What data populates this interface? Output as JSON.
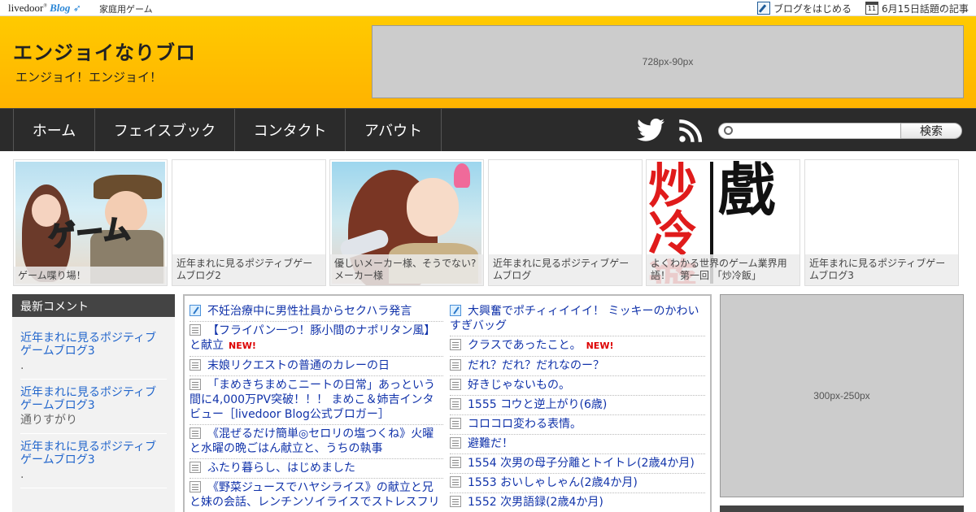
{
  "topbar": {
    "logo_text": "livedoor",
    "logo_blog": "Blog",
    "category": "家庭用ゲーム",
    "start_blog": "ブログをはじめる",
    "calendar_day": "11",
    "news_link": "6月15日話題の記事"
  },
  "header": {
    "title": "エンジョイなりブロ",
    "subtitle": "エンジョイ！エンジョイ！",
    "banner_label": "728px-90px"
  },
  "nav": {
    "items": [
      "ホーム",
      "フェイスブック",
      "コンタクト",
      "アバウト"
    ],
    "search_button": "検索",
    "search_value": ""
  },
  "thumbs": [
    {
      "caption": "ゲーム喋り場！",
      "image_text": "ゲーム"
    },
    {
      "caption": "近年まれに見るポジティブゲームブログ2"
    },
    {
      "caption": "優しいメーカー様、そうでない?メーカー様"
    },
    {
      "caption": "近年まれに見るポジティブゲームブログ"
    },
    {
      "caption": "よくわかる世界のゲーム業界用語！　第一回 「炒冷飯」",
      "image_text": "炒冷 遊戲"
    },
    {
      "caption": "近年まれに見るポジティブゲームブログ3"
    }
  ],
  "sidebar": {
    "heading": "最新コメント",
    "comments": [
      {
        "title": "近年まれに見るポジティブゲームブログ3",
        "author": "."
      },
      {
        "title": "近年まれに見るポジティブゲームブログ3",
        "author": "通りすがり"
      },
      {
        "title": "近年まれに見るポジティブゲームブログ3",
        "author": "."
      }
    ]
  },
  "entries_left": [
    {
      "text": "不妊治療中に男性社員からセクハラ発言",
      "icon": "blue"
    },
    {
      "text": "【フライパン一つ！豚小間のナポリタン風】と献立",
      "new": "NEW!"
    },
    {
      "text": "末娘リクエストの普通のカレーの日"
    },
    {
      "text": "「まめきちまめこニートの日常」あっという間に4,000万PV突破！！！ まめこ＆姉吉インタビュー［livedoor Blog公式ブロガー］"
    },
    {
      "text": "《混ぜるだけ簡単◎セロリの塩つくね》火曜と水曜の晩ごはん献立と、うちの執事"
    },
    {
      "text": "ふたり暮らし、はじめました"
    },
    {
      "text": "《野菜ジュースでハヤシライス》の献立と兄と妹の会話、レンチンソイライスでストレスフリー"
    }
  ],
  "entries_right": [
    {
      "text": "大興奮でポチィィイイイ！ ミッキーのかわいすぎバッグ",
      "icon": "blue"
    },
    {
      "text": "クラスであったこと。",
      "new": "NEW!"
    },
    {
      "text": "だれ？だれ？だれなのー？"
    },
    {
      "text": "好きじゃないもの。"
    },
    {
      "text": "1555 コウと逆上がり(6歳)"
    },
    {
      "text": "コロコロ変わる表情。"
    },
    {
      "text": "避難だ！"
    },
    {
      "text": "1554 次男の母子分離とトイトレ(2歳4か月)"
    },
    {
      "text": "1553 おいしゃしゃん(2歳4か月)"
    },
    {
      "text": "1552 次男語録(2歳4か月)"
    }
  ],
  "ad_right_label": "300px-250px"
}
